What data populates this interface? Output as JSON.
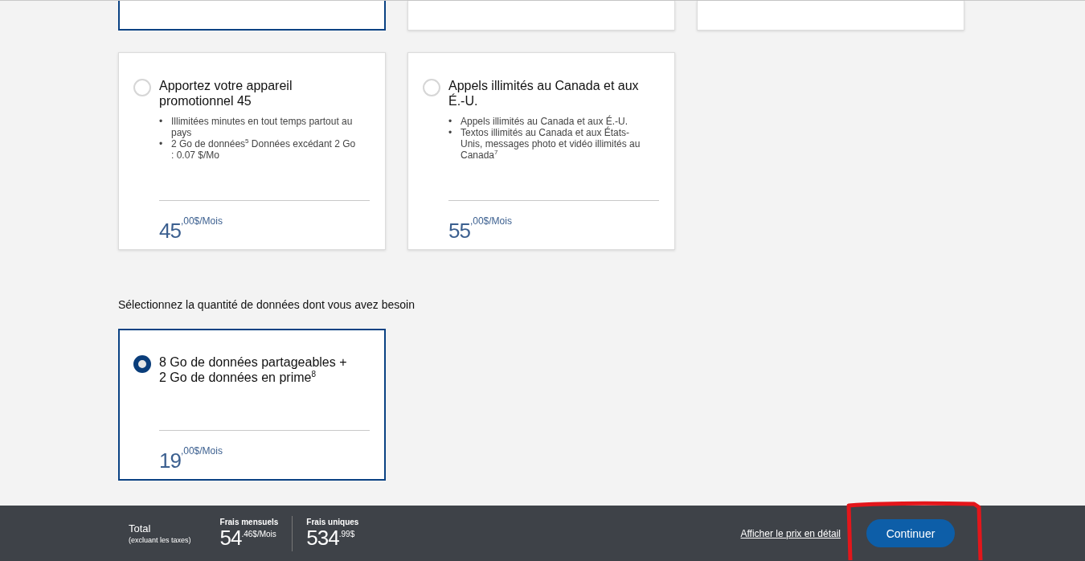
{
  "top_plans": [
    {
      "selected": true
    },
    {
      "selected": false
    },
    {
      "selected": false
    }
  ],
  "plans": [
    {
      "title": "Apportez votre appareil promotionnel 45",
      "selected": false,
      "features": [
        {
          "marker": "•",
          "text": "Illimitées minutes en tout temps partout au pays"
        },
        {
          "marker": "•",
          "text": "2 Go de données$^{5}$ Données excédant 2 Go : 0.07 $/Mo"
        }
      ],
      "price": "45",
      "price_suffix": ",00$/Mois"
    },
    {
      "title": "Appels illimités au Canada et aux É.-U.",
      "selected": false,
      "features": [
        {
          "marker": "•",
          "text": "Appels illimités au Canada et aux É.-U."
        },
        {
          "marker": "•",
          "text": "Textos illimités au Canada et aux États-Unis, messages photo et vidéo illimités au Canada$^{7}$"
        }
      ],
      "price": "55",
      "price_suffix": ",00$/Mois"
    }
  ],
  "data_section": {
    "heading": "Sélectionnez la quantité de données dont vous avez besoin",
    "options": [
      {
        "title": "8 Go de données partageables + 2 Go de données en prime$^{8}$",
        "selected": true,
        "price": "19",
        "price_suffix": ",00$/Mois"
      }
    ]
  },
  "footer": {
    "total_label": "Total",
    "total_note": "(excluant les taxes)",
    "monthly_label": "Frais mensuels",
    "monthly_price": "54",
    "monthly_suffix": ".46$/Mois",
    "onetime_label": "Frais uniques",
    "onetime_price": "534",
    "onetime_suffix": ".99$",
    "details_link": "Afficher le prix en détail",
    "continue_button": "Continuer"
  }
}
